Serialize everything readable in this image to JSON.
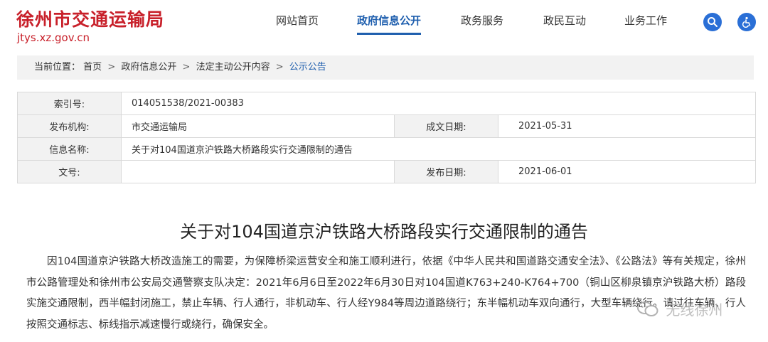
{
  "site": {
    "name": "徐州市交通运输局",
    "domain": "jtys.xz.gov.cn"
  },
  "nav": {
    "items": [
      {
        "label": "网站首页"
      },
      {
        "label": "政府信息公开"
      },
      {
        "label": "政务服务"
      },
      {
        "label": "政民互动"
      },
      {
        "label": "业务工作"
      }
    ],
    "active_index": 1,
    "search_icon": "search-icon",
    "accessibility_icon": "wheelchair-icon"
  },
  "breadcrumb": {
    "prefix": "当前位置：",
    "items": [
      "首页",
      "政府信息公开",
      "法定主动公开内容",
      "公示公告"
    ],
    "separator": ">"
  },
  "meta": {
    "index_label": "索引号:",
    "index_value": "014051538/2021-00383",
    "publisher_label": "发布机构:",
    "publisher_value": "市交通运输局",
    "created_label": "成文日期:",
    "created_value": "2021-05-31",
    "name_label": "信息名称:",
    "name_value": "关于对104国道京沪铁路大桥路段实行交通限制的通告",
    "docno_label": "文号:",
    "docno_value": "",
    "published_label": "发布日期:",
    "published_value": "2021-06-01"
  },
  "article": {
    "title": "关于对104国道京沪铁路大桥路段实行交通限制的通告",
    "body": "因104国道京沪铁路大桥改造施工的需要，为保障桥梁运营安全和施工顺利进行，依据《中华人民共和国道路交通安全法》、《公路法》等有关规定，徐州市公路管理处和徐州市公安局交通警察支队决定：2021年6月6日至2022年6月30日对104国道K763+240-K764+700（铜山区柳泉镇京沪铁路大桥）路段实施交通限制，西半幅封闭施工，禁止车辆、行人通行，非机动车、行人经Y984等周边道路绕行；东半幅机动车双向通行，大型车辆绕行。请过往车辆、行人按照交通标志、标线指示减速慢行或绕行，确保安全。"
  },
  "watermark": {
    "text": "无线徐州"
  },
  "colors": {
    "brand_red": "#c8202a",
    "nav_active": "#1f5fae",
    "icon_blue": "#2a6fd6"
  }
}
